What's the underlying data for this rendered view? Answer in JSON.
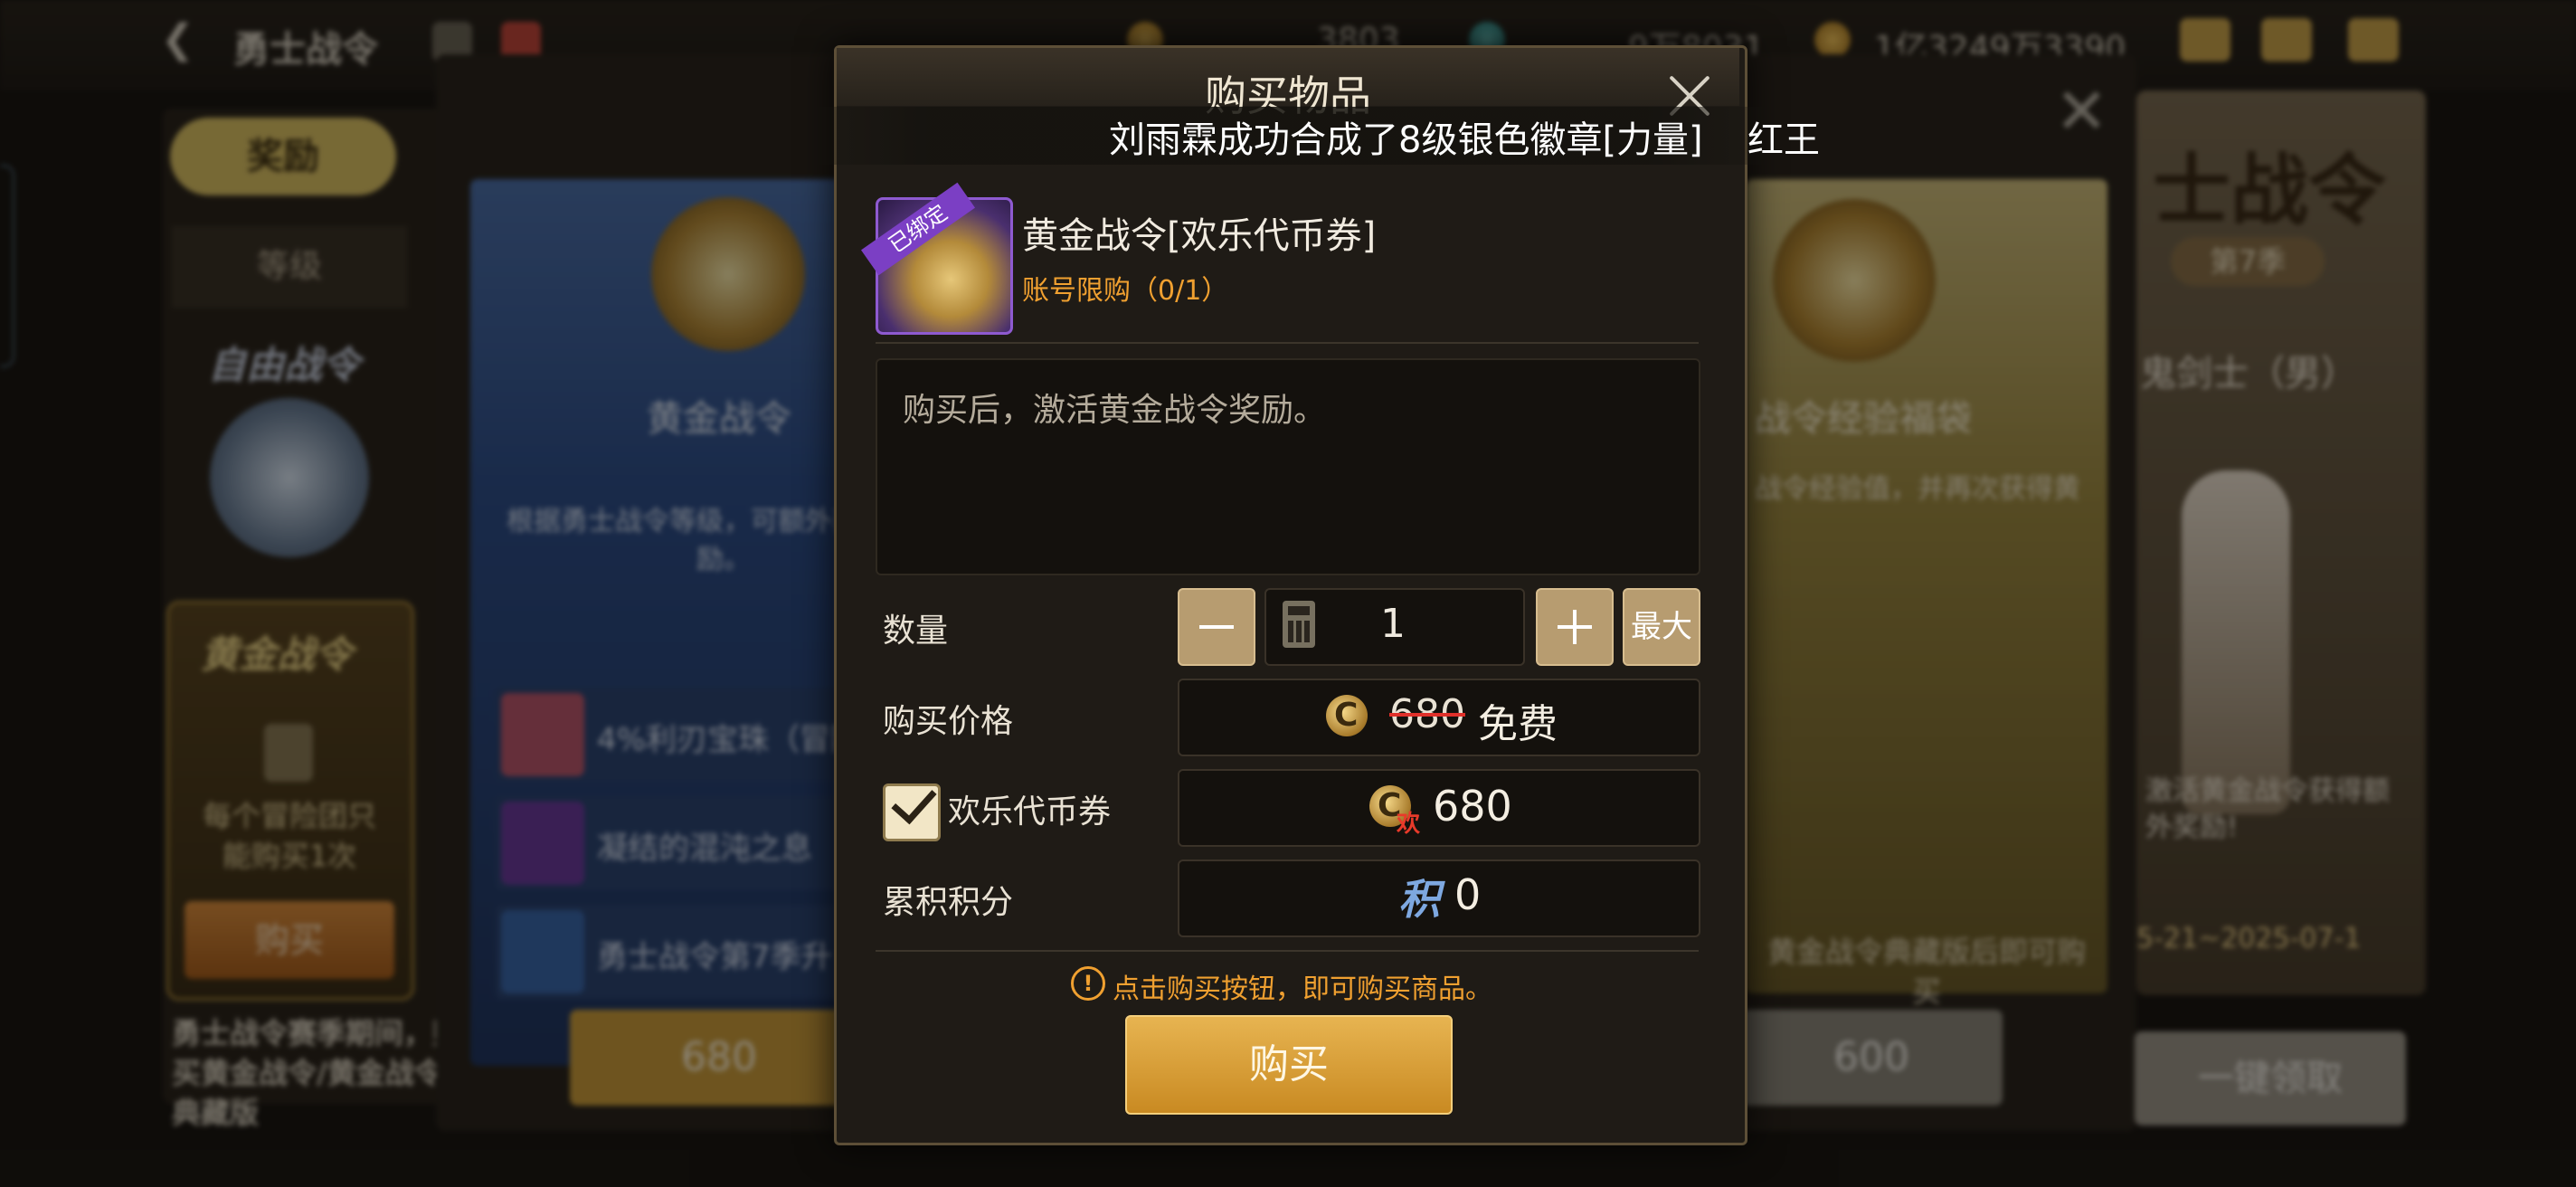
{
  "topbar": {
    "back_title": "勇士战令",
    "currency1": "3803",
    "currency2": "9万8031",
    "currency3": "1亿3249万3390"
  },
  "sidebar": {
    "reward_tab": "奖励",
    "level_tab": "等级",
    "free_pass_title": "自由战令",
    "gold_pass_title": "黄金战令",
    "gold_pass_note": "每个冒险团只能购买1次",
    "buy_button": "购买",
    "bottom_note": "勇士战令赛季期间，购买黄金战令/黄金战令典藏版"
  },
  "background_cards": {
    "left_title": "黄金战令",
    "left_desc": "根据勇士战令等级，可额外获得令奖励。",
    "list_items": [
      "4%利刃宝珠（冒险",
      "凝结的混沌之息",
      "勇士战令第7季升"
    ],
    "left_price": "680",
    "right_title": "战令经验福袋",
    "right_desc": "战令经验值，并再次获得黄",
    "right_note": "黄金战令典藏版后即可购买",
    "right_price": "600",
    "char_title": "士战令",
    "char_season": "第7季",
    "char_class": "鬼剑士（男）",
    "char_desc": "激活黄金战令获得额外奖励!",
    "char_date": "5-21~2025-07-1",
    "onekey_button": "一键领取"
  },
  "dialog": {
    "title": "购买物品",
    "broadcast": "刘雨霖成功合成了8级银色徽章[力量]",
    "broadcast_tail": "红王",
    "item_tag": "已绑定",
    "item_name": "黄金战令[欢乐代币券]",
    "item_limit": "账号限购（0/1）",
    "description": "购买后，激活黄金战令奖励。",
    "quantity_label": "数量",
    "quantity_value": "1",
    "max_label": "最大",
    "price_label": "购买价格",
    "price_original": "680",
    "price_free": "免费",
    "coupon_label": "欢乐代币券",
    "coupon_tag": "欢",
    "coupon_value": "680",
    "points_label": "累积积分",
    "points_glyph": "积",
    "points_value": "0",
    "hint": "点击购买按钮，即可购买商品。",
    "buy_button": "购买"
  }
}
